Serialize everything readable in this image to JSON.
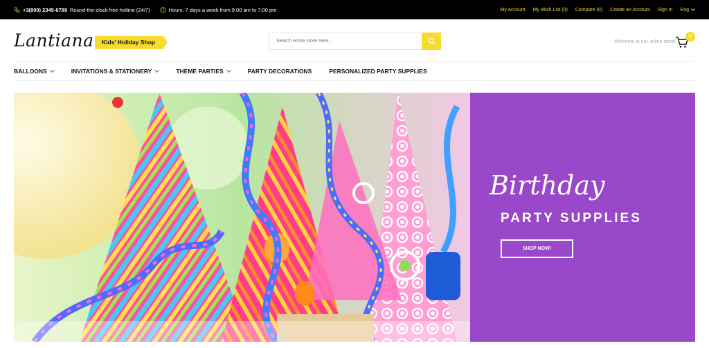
{
  "topbar": {
    "phone": "+3(800) 2345-6789",
    "hotline": "Round-the-clock free hotline (24/7)",
    "hours": "Hours: 7 days a week from 9:00 am to 7:00 pm",
    "links": [
      "My Account",
      "My Wish List (0)",
      "Compare (0)",
      "Create an Account",
      "Sign In"
    ],
    "language": "Eng"
  },
  "header": {
    "logo": "Lantiana",
    "tagline": "Kids' Holiday Shop",
    "search_placeholder": "Search entire store here...",
    "welcome": "Welcome to our online store!",
    "cart_count": "0"
  },
  "nav": {
    "items": [
      {
        "label": "Balloons",
        "dropdown": true
      },
      {
        "label": "Invitations & Stationery",
        "dropdown": true
      },
      {
        "label": "Theme Parties",
        "dropdown": true
      },
      {
        "label": "Party Decorations",
        "dropdown": false
      },
      {
        "label": "Personalized Party Supplies",
        "dropdown": false
      }
    ]
  },
  "banner": {
    "script": "Birthday",
    "subtitle": "PARTY SUPPLIES",
    "cta": "SHOP NOW!",
    "panel_color": "#9848c8"
  },
  "colors": {
    "accent": "#f7dc2f",
    "topbar_bg": "#000000",
    "link": "#f1d34a"
  },
  "icons": {
    "phone": "phone-icon",
    "clock": "clock-icon",
    "search": "search-icon",
    "cart": "cart-icon",
    "lang_dropdown": "chevron-down-icon"
  }
}
